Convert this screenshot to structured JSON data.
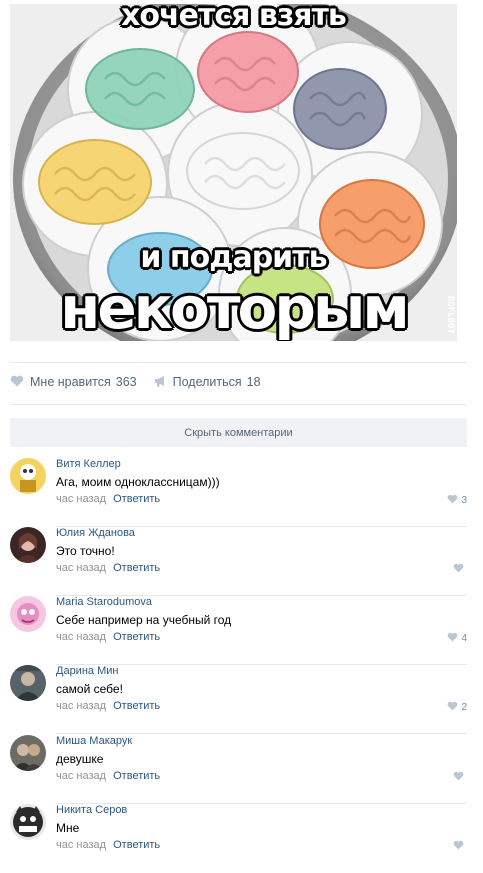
{
  "meme": {
    "top_text": "хочется взять",
    "middle_text": "и подарить",
    "bottom_text": "некоторым",
    "watermark": "ROFLBOT"
  },
  "actions": {
    "like_label": "Мне нравится",
    "like_count": "363",
    "share_label": "Поделиться",
    "share_count": "18"
  },
  "hide_comments_label": "Скрыть комментарии",
  "comments": [
    {
      "author": "Витя Келлер",
      "text": "Ага, моим одноклассницам)))",
      "time": "час назад",
      "reply": "Ответить",
      "likes": "3",
      "avatar_color": "#e9c54d"
    },
    {
      "author": "Юлия Жданова",
      "text": "Это точно!",
      "time": "час назад",
      "reply": "Ответить",
      "likes": "",
      "avatar_color": "#6b3b33"
    },
    {
      "author": "Maria Starodumova",
      "text": "Себе например на учебный год",
      "time": "час назад",
      "reply": "Ответить",
      "likes": "4",
      "avatar_color": "#f3b3d6"
    },
    {
      "author": "Дарина Мин",
      "text": "самой себе!",
      "time": "час назад",
      "reply": "Ответить",
      "likes": "2",
      "avatar_color": "#3e4a4e"
    },
    {
      "author": "Миша Макарук",
      "text": "девушке",
      "time": "час назад",
      "reply": "Ответить",
      "likes": "",
      "avatar_color": "#4a4a46"
    },
    {
      "author": "Никита Серов",
      "text": "Мне",
      "time": "час назад",
      "reply": "Ответить",
      "likes": "",
      "avatar_color": "#2b2b2b"
    }
  ],
  "colors": {
    "link": "#2a5885",
    "muted": "#939393",
    "actions": "#55677d",
    "bar_bg": "#f0f2f5"
  }
}
